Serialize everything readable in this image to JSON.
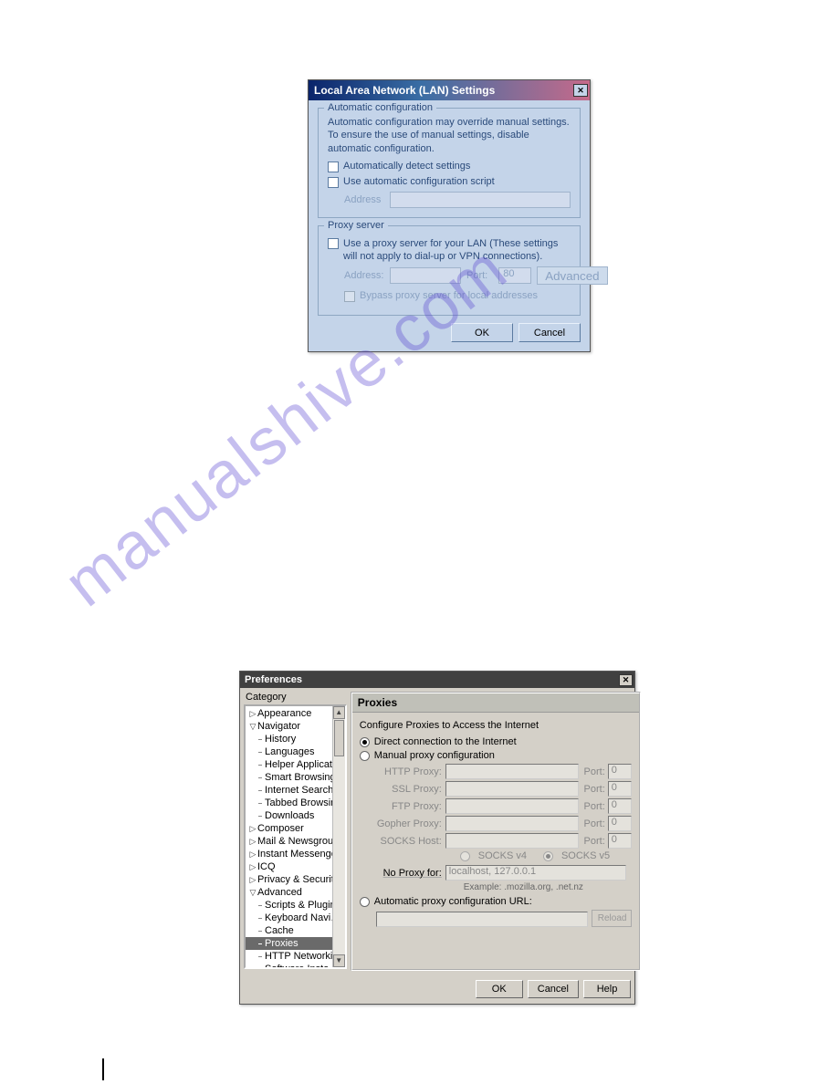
{
  "watermark": "manualshive.com",
  "lan": {
    "title": "Local Area Network (LAN) Settings",
    "auto": {
      "legend": "Automatic configuration",
      "desc": "Automatic configuration may override manual settings. To ensure the use of manual settings, disable automatic configuration.",
      "detect_label": "Automatically detect settings",
      "script_label": "Use automatic configuration script",
      "address_label": "Address"
    },
    "proxy": {
      "legend": "Proxy server",
      "use_label": "Use a proxy server for your LAN (These settings will not apply to dial-up or VPN connections).",
      "address_label": "Address:",
      "port_label": "Port:",
      "port_value": "80",
      "advanced_label": "Advanced",
      "bypass_label": "Bypass proxy server for local addresses"
    },
    "buttons": {
      "ok": "OK",
      "cancel": "Cancel"
    }
  },
  "pref": {
    "title": "Preferences",
    "category_label": "Category",
    "tree": {
      "items": [
        {
          "label": "Appearance",
          "level": 0,
          "tw": "▷"
        },
        {
          "label": "Navigator",
          "level": 0,
          "tw": "▽"
        },
        {
          "label": "History",
          "level": 1
        },
        {
          "label": "Languages",
          "level": 1
        },
        {
          "label": "Helper Applicat…",
          "level": 1
        },
        {
          "label": "Smart Browsing",
          "level": 1
        },
        {
          "label": "Internet Search",
          "level": 1
        },
        {
          "label": "Tabbed Browsing",
          "level": 1
        },
        {
          "label": "Downloads",
          "level": 1
        },
        {
          "label": "Composer",
          "level": 0,
          "tw": "▷"
        },
        {
          "label": "Mail & Newsgroups",
          "level": 0,
          "tw": "▷"
        },
        {
          "label": "Instant Messenger",
          "level": 0,
          "tw": "▷"
        },
        {
          "label": "ICQ",
          "level": 0,
          "tw": "▷"
        },
        {
          "label": "Privacy & Security",
          "level": 0,
          "tw": "▷"
        },
        {
          "label": "Advanced",
          "level": 0,
          "tw": "▽"
        },
        {
          "label": "Scripts & Plugins",
          "level": 1
        },
        {
          "label": "Keyboard Navi…",
          "level": 1
        },
        {
          "label": "Cache",
          "level": 1
        },
        {
          "label": "Proxies",
          "level": 1,
          "selected": true
        },
        {
          "label": "HTTP Networking",
          "level": 1
        },
        {
          "label": "Software Insta…",
          "level": 1
        }
      ]
    },
    "panel": {
      "header": "Proxies",
      "subtitle": "Configure Proxies to Access the Internet",
      "radio_direct": "Direct connection to the Internet",
      "radio_manual": "Manual proxy configuration",
      "rows": {
        "http": "HTTP Proxy:",
        "ssl": "SSL Proxy:",
        "ftp": "FTP Proxy:",
        "gopher": "Gopher Proxy:",
        "socks": "SOCKS Host:"
      },
      "port_label": "Port:",
      "port_default": "0",
      "socks4": "SOCKS v4",
      "socks5": "SOCKS v5",
      "noproxy_label": "No Proxy for:",
      "noproxy_value": "localhost, 127.0.0.1",
      "example": "Example: .mozilla.org, .net.nz",
      "radio_auto": "Automatic proxy configuration URL:",
      "reload": "Reload"
    },
    "buttons": {
      "ok": "OK",
      "cancel": "Cancel",
      "help": "Help"
    }
  }
}
